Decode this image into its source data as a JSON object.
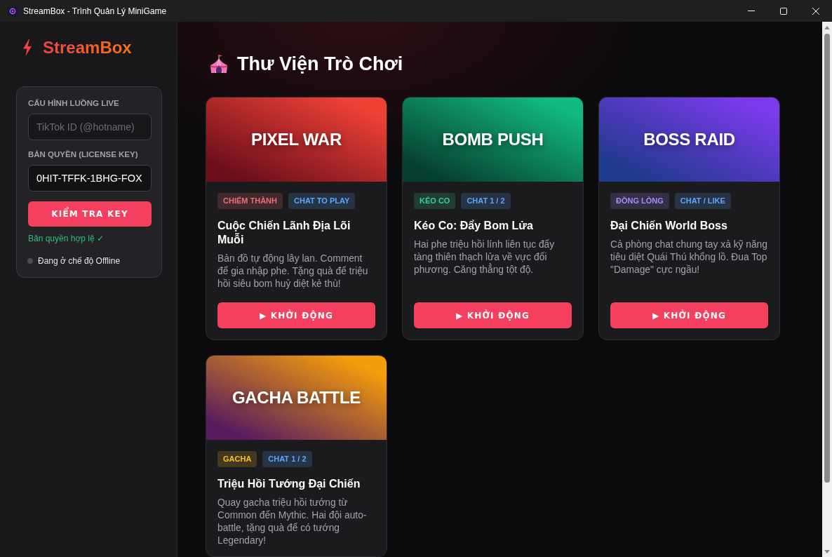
{
  "window": {
    "title": "StreamBox - Trình Quản Lý MiniGame"
  },
  "sidebar": {
    "brand": "StreamBox",
    "config": {
      "heading": "CẤU HÌNH LUỒNG LIVE",
      "tiktok_field": {
        "placeholder": "TikTok ID (@hotname)"
      },
      "license_label": "BẢN QUYỀN (LICENSE KEY)",
      "license_field": {
        "value": "0HIT-TFFK-1BHG-FOX"
      },
      "check_button": "KIỂM TRA KEY",
      "license_status": {
        "text": "Bản quyền hợp lệ ✓",
        "valid": true
      },
      "connection": {
        "text": "Đang ở chế độ Offline",
        "online": false
      }
    }
  },
  "main": {
    "heading": "Thư Viện Trò Chơi",
    "games": [
      {
        "banner_title": "PIXEL WAR",
        "gradient": [
          {
            "color": "#6b0f1a"
          },
          {
            "color": "#ef4136"
          }
        ],
        "tags": [
          {
            "text": "CHIẾM THÀNH",
            "color": "#412a2d"
          },
          {
            "text": "CHAT TO PLAY",
            "color": "#273446"
          }
        ],
        "title": "Cuộc Chiến Lãnh Địa Lõi Muỗi",
        "description": "Bản đồ tự động lây lan. Comment để gia nhập phe. Tặng quà để triệu hồi siêu bom huỷ diệt kẻ thù!",
        "button": "▶ KHỞI ĐỘNG"
      },
      {
        "banner_title": "BOMB PUSH",
        "gradient": [
          {
            "color": "#063f2f"
          },
          {
            "color": "#12b981"
          }
        ],
        "tags": [
          {
            "text": "KÉO CO",
            "color": "#203c34"
          },
          {
            "text": "CHAT 1 / 2",
            "color": "#273446"
          }
        ],
        "title": "Kéo Co: Đẩy Bom Lửa",
        "description": "Hai phe triệu hồi lính liên tục đẩy tàng thiên thạch lửa về vực đối phương. Căng thẳng tột độ.",
        "button": "▶ KHỞI ĐỘNG"
      },
      {
        "banner_title": "BOSS RAID",
        "gradient": [
          {
            "color": "#1e3a8a"
          },
          {
            "color": "#7c3aed"
          }
        ],
        "tags": [
          {
            "text": "ĐỒNG LÒNG",
            "color": "#342f46"
          },
          {
            "text": "CHAT / LIKE",
            "color": "#273446"
          }
        ],
        "title": "Đại Chiến World Boss",
        "description": "Cả phòng chat chung tay xả kỹ năng tiêu diệt Quái Thú khổng lồ. Đua Top \"Damage\" cực ngầu!",
        "button": "▶ KHỞI ĐỘNG"
      },
      {
        "banner_title": "GACHA BATTLE",
        "gradient": [
          {
            "color": "#581c5e"
          },
          {
            "color": "#f59e0b"
          }
        ],
        "tags": [
          {
            "text": "GACHA",
            "color": "#43391f"
          },
          {
            "text": "CHAT 1 / 2",
            "color": "#273446"
          }
        ],
        "title": "Triệu Hồi Tướng Đại Chiến",
        "description": "Quay gacha triệu hồi tướng từ Common đến Mythic. Hai đội auto-battle, tặng quà để có tướng Legendary!"
      }
    ]
  }
}
